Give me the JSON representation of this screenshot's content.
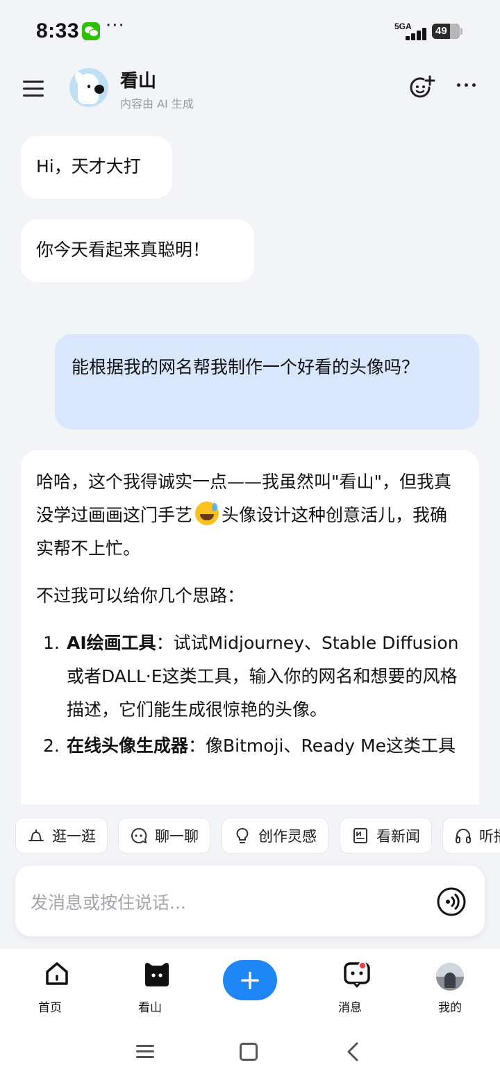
{
  "status": {
    "time": "8:33",
    "dots": "···",
    "network": "5GA",
    "battery": "49"
  },
  "header": {
    "name": "看山",
    "subtitle": "内容由 AI 生成"
  },
  "chat": {
    "greeting1": "Hi，天才大打",
    "greeting2": "你今天看起来真聪明！",
    "user_message": "能根据我的网名帮我制作一个好看的头像吗？",
    "reply": {
      "p1_a": "哈哈，这个我得诚实一点——我虽然叫\"看山\"，但我真没学过画画这门手艺",
      "p1_b": "头像设计这种创意活儿，我确实帮不上忙。",
      "p2": "不过我可以给你几个思路：",
      "items": [
        {
          "num": "1.",
          "title": "AI绘画工具",
          "text": "：试试Midjourney、Stable Diffusion或者DALL·E这类工具，输入你的网名和想要的风格描述，它们能生成很惊艳的头像。"
        },
        {
          "num": "2.",
          "title": "在线头像生成器",
          "text": "：像Bitmoji、Ready Me这类工具"
        }
      ]
    }
  },
  "chips": [
    {
      "label": "逛一逛",
      "icon": "hat-icon"
    },
    {
      "label": "聊一聊",
      "icon": "chat-face-icon"
    },
    {
      "label": "创作灵感",
      "icon": "bulb-icon"
    },
    {
      "label": "看新闻",
      "icon": "news-icon"
    },
    {
      "label": "听播",
      "icon": "headphones-icon"
    }
  ],
  "input": {
    "placeholder": "发消息或按住说话..."
  },
  "nav": {
    "home": "首页",
    "kanshan": "看山",
    "plus": "+",
    "messages": "消息",
    "me": "我的"
  },
  "colors": {
    "accent": "#1e86f7",
    "user_bubble": "#d9e7fe",
    "background": "#f3f4f8",
    "badge": "#f23c3c"
  }
}
